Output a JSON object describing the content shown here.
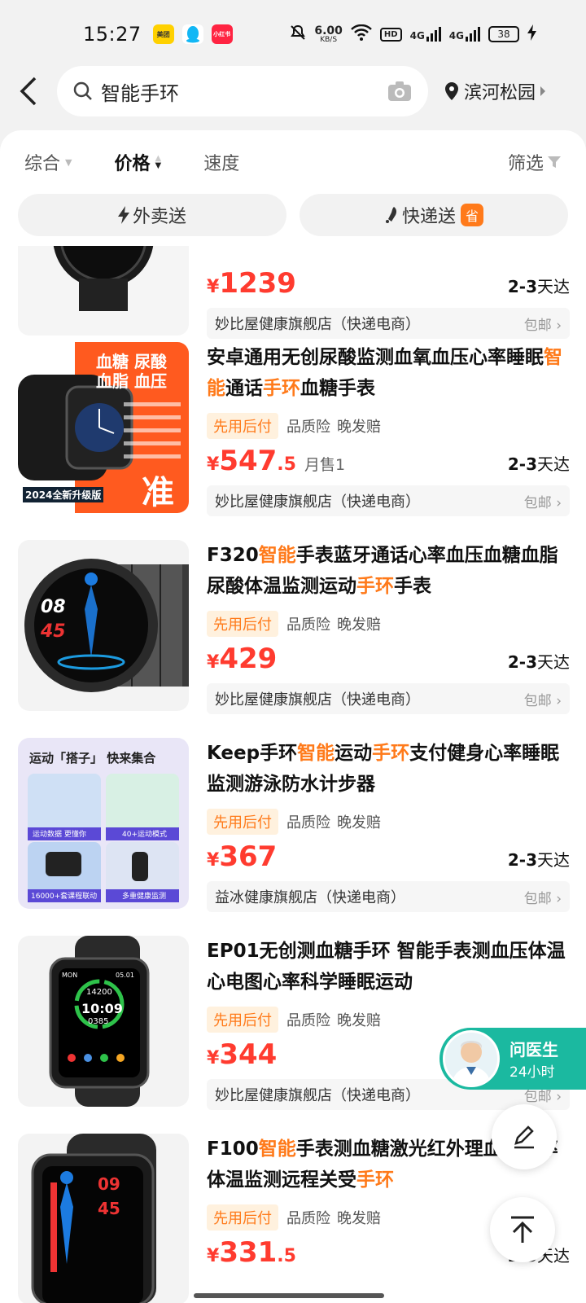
{
  "status_bar": {
    "time": "15:27",
    "app_badges": [
      "美团",
      "QQ",
      "小红书"
    ],
    "net_speed_value": "6.00",
    "net_speed_unit": "KB/S",
    "hd": "HD",
    "signal1": "4G",
    "signal2": "4G",
    "battery": "38"
  },
  "search": {
    "query": "智能手环",
    "location": "滨河松园"
  },
  "sort_bar": {
    "items": [
      "综合",
      "价格",
      "速度"
    ],
    "filter": "筛选"
  },
  "delivery": {
    "takeaway": "外卖送",
    "express": "快递送",
    "save_badge": "省"
  },
  "products": [
    {
      "title_parts": [],
      "tags": [],
      "price_int": "1239",
      "price_dec": "",
      "sold": "",
      "eta_bold": "2-3",
      "eta_suffix": "天达",
      "shop": "妙比屋健康旗舰店（快递电商）",
      "ship": "包邮"
    },
    {
      "title_parts": [
        {
          "text": "安卓通用无创尿酸监测血氧血压心率睡眠",
          "hl": false
        },
        {
          "text": "智能",
          "hl": true
        },
        {
          "text": "通话",
          "hl": false
        },
        {
          "text": "手环",
          "hl": true
        },
        {
          "text": "血糖手表",
          "hl": false
        }
      ],
      "tags": [
        "先用后付",
        "品质险",
        "晚发赔"
      ],
      "price_int": "547",
      "price_dec": ".5",
      "sold": "月售1",
      "eta_bold": "2-3",
      "eta_suffix": "天达",
      "shop": "妙比屋健康旗舰店（快递电商）",
      "ship": "包邮",
      "thumb_texts": [
        "血糖 尿酸",
        "血脂 血压",
        "2024全新升级版",
        "准"
      ]
    },
    {
      "title_parts": [
        {
          "text": "F320",
          "hl": false
        },
        {
          "text": "智能",
          "hl": true
        },
        {
          "text": "手表蓝牙通话心率血压血糖血脂尿酸体温监测运动",
          "hl": false
        },
        {
          "text": "手环",
          "hl": true
        },
        {
          "text": "手表",
          "hl": false
        }
      ],
      "tags": [
        "先用后付",
        "品质险",
        "晚发赔"
      ],
      "price_int": "429",
      "price_dec": "",
      "sold": "",
      "eta_bold": "2-3",
      "eta_suffix": "天达",
      "shop": "妙比屋健康旗舰店（快递电商）",
      "ship": "包邮",
      "thumb_texts": [
        "08",
        "45"
      ]
    },
    {
      "title_parts": [
        {
          "text": "Keep手环",
          "hl": false
        },
        {
          "text": "智能",
          "hl": true
        },
        {
          "text": "运动",
          "hl": false
        },
        {
          "text": "手环",
          "hl": true
        },
        {
          "text": "支付健身心率睡眠监测游泳防水计步器",
          "hl": false
        }
      ],
      "tags": [
        "先用后付",
        "品质险",
        "晚发赔"
      ],
      "price_int": "367",
      "price_dec": "",
      "sold": "",
      "eta_bold": "2-3",
      "eta_suffix": "天达",
      "shop": "益冰健康旗舰店（快递电商）",
      "ship": "包邮",
      "thumb_texts": [
        "运动「搭子」 快来集合",
        "运动数据 更懂你",
        "40+运动模式",
        "16000+套课程联动",
        "多重健康监测"
      ]
    },
    {
      "title_parts": [
        {
          "text": "EP01无创测血糖手环 智能手表测血压体温心电图心率科学睡眠运动",
          "hl": false
        }
      ],
      "tags": [
        "先用后付",
        "品质险",
        "晚发赔"
      ],
      "price_int": "344",
      "price_dec": "",
      "sold": "",
      "eta_bold": "",
      "eta_suffix": "",
      "shop": "妙比屋健康旗舰店（快递电商）",
      "ship": "包邮",
      "thumb_texts": [
        "MON",
        "05.01",
        "14200",
        "10:09",
        "0385"
      ]
    },
    {
      "title_parts": [
        {
          "text": "F100",
          "hl": false
        },
        {
          "text": "智能",
          "hl": true
        },
        {
          "text": "手表测血糖激光红外理血氧心率体温监测远程关受",
          "hl": false
        },
        {
          "text": "手环",
          "hl": true
        }
      ],
      "tags": [
        "先用后付",
        "品质险",
        "晚发赔"
      ],
      "price_int": "331",
      "price_dec": ".5",
      "sold": "",
      "eta_bold": "2-3",
      "eta_suffix": "天达",
      "shop": "",
      "ship": "",
      "thumb_texts": [
        "09",
        "45"
      ]
    }
  ],
  "doctor_fab": {
    "title": "问医生",
    "subtitle": "24小时"
  },
  "colors": {
    "accent": "#ff7a1a",
    "price": "#ff3b2f",
    "doctor": "#1bb9a0"
  }
}
